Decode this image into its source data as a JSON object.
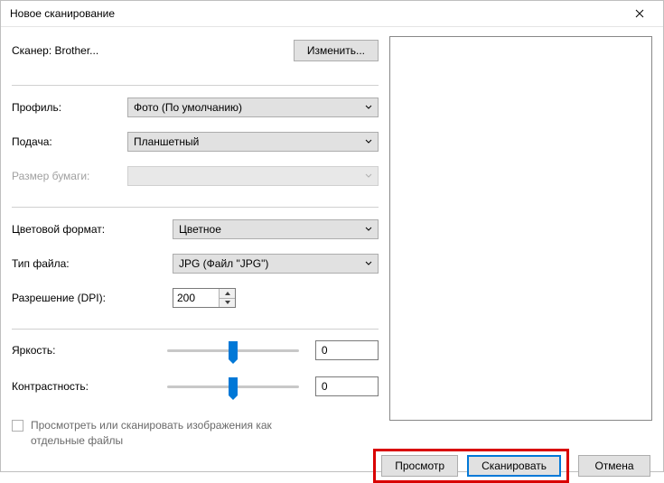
{
  "window": {
    "title": "Новое сканирование"
  },
  "scanner": {
    "label": "Сканер: Brother...",
    "change_btn": "Изменить..."
  },
  "form": {
    "profile_label": "Профиль:",
    "profile_value": "Фото (По умолчанию)",
    "source_label": "Подача:",
    "source_value": "Планшетный",
    "papersize_label": "Размер бумаги:",
    "papersize_value": "",
    "colorformat_label": "Цветовой формат:",
    "colorformat_value": "Цветное",
    "filetype_label": "Тип файла:",
    "filetype_value": "JPG (Файл \"JPG\")",
    "dpi_label": "Разрешение (DPI):",
    "dpi_value": "200",
    "brightness_label": "Яркость:",
    "brightness_value": "0",
    "contrast_label": "Контрастность:",
    "contrast_value": "0"
  },
  "checkbox": {
    "label": "Просмотреть или сканировать изображения как отдельные файлы"
  },
  "buttons": {
    "preview": "Просмотр",
    "scan": "Сканировать",
    "cancel": "Отмена"
  }
}
